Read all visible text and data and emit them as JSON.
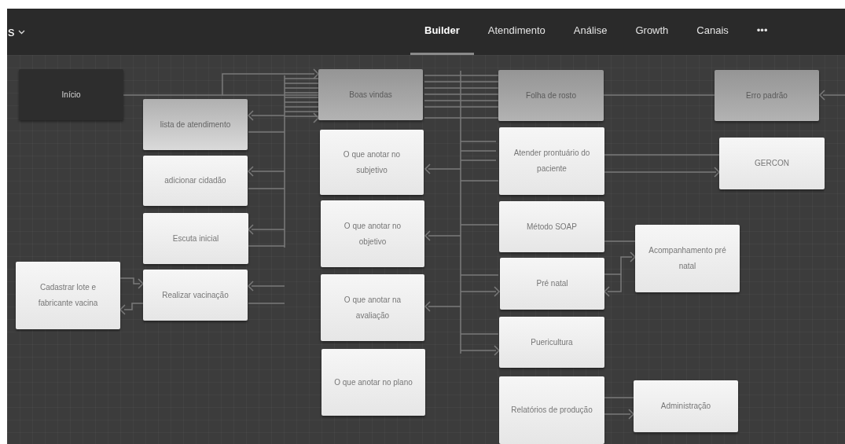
{
  "header": {
    "title_fragment": "s"
  },
  "tabs": [
    {
      "label": "Builder",
      "selected": true
    },
    {
      "label": "Atendimento",
      "selected": false
    },
    {
      "label": "Análise",
      "selected": false
    },
    {
      "label": "Growth",
      "selected": false
    },
    {
      "label": "Canais",
      "selected": false
    },
    {
      "label": "•••",
      "selected": false
    }
  ],
  "nodes": [
    {
      "label": "Início",
      "kind": "dark"
    },
    {
      "label": "lista de atendimento",
      "kind": "silver"
    },
    {
      "label": "adicionar cidadão",
      "kind": "light"
    },
    {
      "label": "Escuta inicial",
      "kind": "light"
    },
    {
      "label": "Cadastrar lote e fabricante vacina",
      "kind": "light"
    },
    {
      "label": "Realizar vacinação",
      "kind": "light"
    },
    {
      "label": "Boas vindas",
      "kind": "gray"
    },
    {
      "label": "O que anotar no subjetivo",
      "kind": "light"
    },
    {
      "label": "O que anotar no objetivo",
      "kind": "light"
    },
    {
      "label": "O que anotar na avaliação",
      "kind": "light"
    },
    {
      "label": "O que anotar no plano",
      "kind": "light"
    },
    {
      "label": "Folha de rosto",
      "kind": "gray"
    },
    {
      "label": "Atender prontuário do paciente",
      "kind": "light"
    },
    {
      "label": "Método SOAP",
      "kind": "light"
    },
    {
      "label": "Pré natal",
      "kind": "light"
    },
    {
      "label": "Puericultura",
      "kind": "light"
    },
    {
      "label": "Relatórios de produção",
      "kind": "light"
    },
    {
      "label": "Erro padrão",
      "kind": "gray"
    },
    {
      "label": "GERCON",
      "kind": "light"
    },
    {
      "label": "Acompanhamento pré natal",
      "kind": "light"
    },
    {
      "label": "Administração",
      "kind": "light"
    }
  ]
}
